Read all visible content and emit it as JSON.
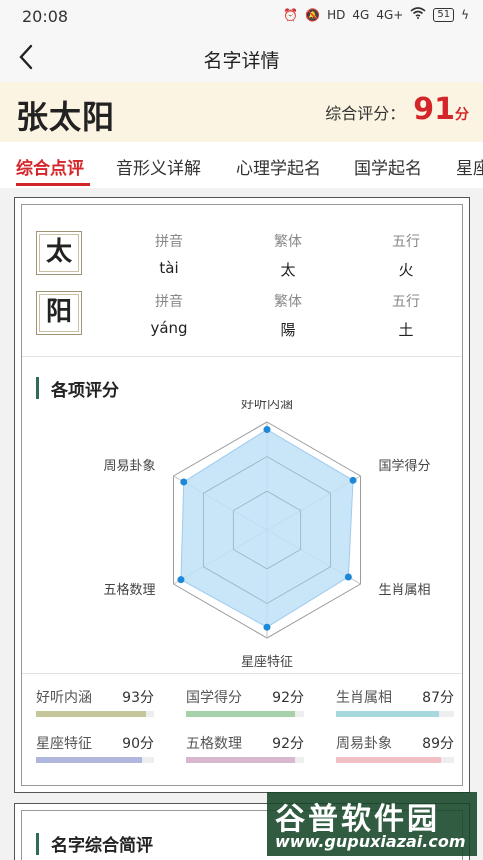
{
  "status": {
    "time": "20:08",
    "icons": [
      "alarm-icon",
      "mute-icon",
      "hd-icon",
      "signal-4g-icon",
      "signal-4g-plus-icon",
      "wifi-icon",
      "battery-icon",
      "charging-icon"
    ],
    "hd_label": "HD",
    "net1": "4G",
    "net2": "4G+",
    "battery": "51"
  },
  "nav": {
    "title": "名字详情",
    "back_icon": "chevron-left-icon"
  },
  "header": {
    "name": "张太阳",
    "score_label": "综合评分：",
    "score": "91",
    "score_unit": "分"
  },
  "tabs": [
    {
      "label": "综合点评",
      "active": true
    },
    {
      "label": "音形义详解"
    },
    {
      "label": "心理学起名"
    },
    {
      "label": "国学起名"
    },
    {
      "label": "星座"
    }
  ],
  "characters": [
    {
      "char": "太",
      "pinyin_label": "拼音",
      "pinyin": "tài",
      "trad_label": "繁体",
      "trad": "太",
      "wuxing_label": "五行",
      "wuxing": "火"
    },
    {
      "char": "阳",
      "pinyin_label": "拼音",
      "pinyin": "yáng",
      "trad_label": "繁体",
      "trad": "陽",
      "wuxing_label": "五行",
      "wuxing": "土"
    }
  ],
  "scores_section": {
    "title": "各项评分"
  },
  "chart_data": {
    "type": "radar",
    "axes": [
      "好听内涵",
      "国学得分",
      "生肖属相",
      "星座特征",
      "五格数理",
      "周易卦象"
    ],
    "values": [
      93,
      92,
      87,
      90,
      92,
      89
    ],
    "range": [
      0,
      100
    ],
    "fill_color": "#bfe0f7",
    "point_color": "#1e88d6"
  },
  "stats": [
    {
      "name": "好听内涵",
      "value": "93分",
      "level": 0.93,
      "color": "#c5c79a"
    },
    {
      "name": "国学得分",
      "value": "92分",
      "level": 0.92,
      "color": "#a6d1ab"
    },
    {
      "name": "生肖属相",
      "value": "87分",
      "level": 0.87,
      "color": "#a5d9de"
    },
    {
      "name": "星座特征",
      "value": "90分",
      "level": 0.9,
      "color": "#b1b6dc"
    },
    {
      "name": "五格数理",
      "value": "92分",
      "level": 0.92,
      "color": "#d8b8cf"
    },
    {
      "name": "周易卦象",
      "value": "89分",
      "level": 0.89,
      "color": "#f2bfc4"
    }
  ],
  "summary_section": {
    "title": "名字综合简评"
  },
  "watermark": {
    "top": "谷普软件园",
    "bottom": "www.gupuxiazai.com"
  },
  "colors": {
    "accent": "#d4252a",
    "banner": "#fbf4e2",
    "section_bar": "#2f6b58"
  }
}
